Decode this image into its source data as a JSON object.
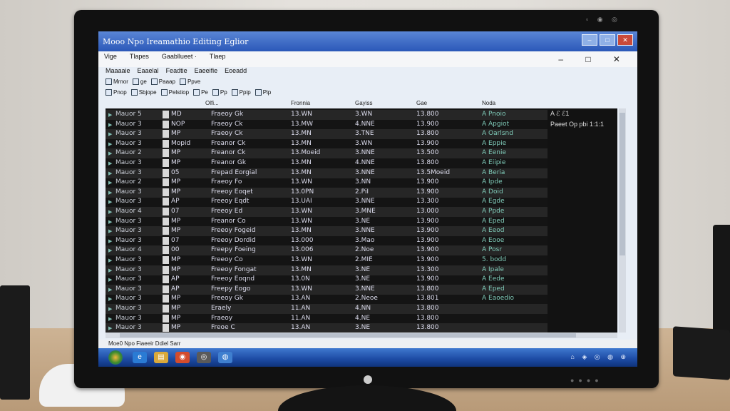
{
  "window": {
    "title": "Mooo Npo Ireamathio Editing Eglior",
    "controls": [
      "–",
      "□",
      "✕"
    ],
    "winctl_right": "– □ ✕"
  },
  "menus": {
    "row1": [
      "Vige",
      "Tlapes",
      "Gaabllueet ·",
      "Tlaep"
    ],
    "row2": [
      "Maaaaie",
      "Eaaelal",
      "Feadtie",
      "Eaeeifie",
      "Eoeadd"
    ]
  },
  "toolbars": {
    "row1": [
      "Mrnor",
      "ge",
      "Paaap",
      "Ppve"
    ],
    "row2": [
      "Pnop",
      "Sbjope",
      "Pelstiop",
      "Pe",
      "Pp",
      "Ppip",
      "Pip"
    ]
  },
  "columns": [
    "Olfi...",
    "Fronnia",
    "Gayiss",
    "Gae",
    "Noda"
  ],
  "rows": [
    {
      "name": "Mauor 5",
      "flag": "MD",
      "freq": "Fraeoy Gk",
      "v1": "13.WN",
      "v2": "3.WN",
      "v3": "13.800",
      "note": "A Pnoio"
    },
    {
      "name": "Mauor 3",
      "flag": "NOP",
      "freq": "Fraeoy Ck",
      "v1": "13.MW",
      "v2": "4.NNE",
      "v3": "13.900",
      "note": "A Apgiot"
    },
    {
      "name": "Mauor 3",
      "flag": "MP",
      "freq": "Fraeoy Ck",
      "v1": "13.MN",
      "v2": "3.TNE",
      "v3": "13.800",
      "note": "A Oarlsnd"
    },
    {
      "name": "Mauor 3",
      "flag": "Mopid",
      "freq": "Freanor Ck",
      "v1": "13.MN",
      "v2": "3.WN",
      "v3": "13.900",
      "note": "A Eppie"
    },
    {
      "name": "Mauor 2",
      "flag": "MP",
      "freq": "Freanor Ck",
      "v1": "13.Moeid",
      "v2": "3.NNE",
      "v3": "13.500",
      "note": "A Eenie"
    },
    {
      "name": "Mauor 3",
      "flag": "MP",
      "freq": "Freanor Gk",
      "v1": "13.MN",
      "v2": "4.NNE",
      "v3": "13.800",
      "note": "A Eiipie"
    },
    {
      "name": "Mauor 3",
      "flag": "05",
      "freq": "Frepad Eorgial",
      "v1": "13.MN",
      "v2": "3.NNE",
      "v3": "13.5Moeid",
      "note": "A Beria"
    },
    {
      "name": "Mauor 2",
      "flag": "MP",
      "freq": "Fraeoy Fo",
      "v1": "13.WN",
      "v2": "3.NN",
      "v3": "13.900",
      "note": "A Ipde"
    },
    {
      "name": "Mauor 3",
      "flag": "MP",
      "freq": "Freeoy Eoqet",
      "v1": "13.0PN",
      "v2": "2.PiI",
      "v3": "13.900",
      "note": "A Doid"
    },
    {
      "name": "Mauor 3",
      "flag": "AP",
      "freq": "Freeoy Eqdt",
      "v1": "13.UAI",
      "v2": "3.NNE",
      "v3": "13.300",
      "note": "A Egde"
    },
    {
      "name": "Mauor 4",
      "flag": "07",
      "freq": "Freeoy Ed",
      "v1": "13.WN",
      "v2": "3.MNE",
      "v3": "13.000",
      "note": "A Ppde"
    },
    {
      "name": "Mauor 3",
      "flag": "MP",
      "freq": "Freanor Co",
      "v1": "13.WN",
      "v2": "3.NE",
      "v3": "13.900",
      "note": "A Eped"
    },
    {
      "name": "Mauor 3",
      "flag": "MP",
      "freq": "Freeoy Fogeid",
      "v1": "13.MN",
      "v2": "3.NNE",
      "v3": "13.900",
      "note": "A Eeod"
    },
    {
      "name": "Mauor 3",
      "flag": "07",
      "freq": "Freeoy Dordid",
      "v1": "13.000",
      "v2": "3.Mao",
      "v3": "13.900",
      "note": "A Eooe"
    },
    {
      "name": "Mauor 4",
      "flag": "00",
      "freq": "Freepy Foeing",
      "v1": "13.006",
      "v2": "2.Noe",
      "v3": "13.900",
      "note": "A Posr"
    },
    {
      "name": "Mauor 3",
      "flag": "MP",
      "freq": "Freeoy Co",
      "v1": "13.WN",
      "v2": "2.MIE",
      "v3": "13.900",
      "note": "5. bodd"
    },
    {
      "name": "Mauor 3",
      "flag": "MP",
      "freq": "Freeoy Fongat",
      "v1": "13.MN",
      "v2": "3.NE",
      "v3": "13.300",
      "note": "A Ipale"
    },
    {
      "name": "Mauor 3",
      "flag": "AP",
      "freq": "Freeoy Eoqnd",
      "v1": "13.0N",
      "v2": "3.NE",
      "v3": "13.900",
      "note": "A Eede"
    },
    {
      "name": "Mauor 3",
      "flag": "AP",
      "freq": "Freepy Eogo",
      "v1": "13.WN",
      "v2": "3.NNE",
      "v3": "13.800",
      "note": "A Eped"
    },
    {
      "name": "Mauor 3",
      "flag": "MP",
      "freq": "Freeoy Gk",
      "v1": "13.AN",
      "v2": "2.Neoe",
      "v3": "13.801",
      "note": "A Eaoedio"
    },
    {
      "name": "Mauor 3",
      "flag": "MP",
      "freq": "Eraely",
      "v1": "11.AN",
      "v2": "4.NN",
      "v3": "13.800",
      "note": ""
    },
    {
      "name": "Mauor 3",
      "flag": "MP",
      "freq": "Fraeoy",
      "v1": "11.AN",
      "v2": "4.NE",
      "v3": "13.800",
      "note": ""
    },
    {
      "name": "Mauor 3",
      "flag": "MP",
      "freq": "Freoe C",
      "v1": "13.AN",
      "v2": "3.NE",
      "v3": "13.800",
      "note": ""
    }
  ],
  "side_info": [
    "A ℰ ℰ1",
    "Paeet Op pbi 1:1:1"
  ],
  "status": "Moe0 Npo Fiaeeir Ddiel Sarr",
  "taskbar": {
    "apps": [
      "e",
      "▤",
      "◉",
      "◎",
      "◍"
    ],
    "tray": "⌂ ◈ ◎ ◍ ⊕"
  }
}
